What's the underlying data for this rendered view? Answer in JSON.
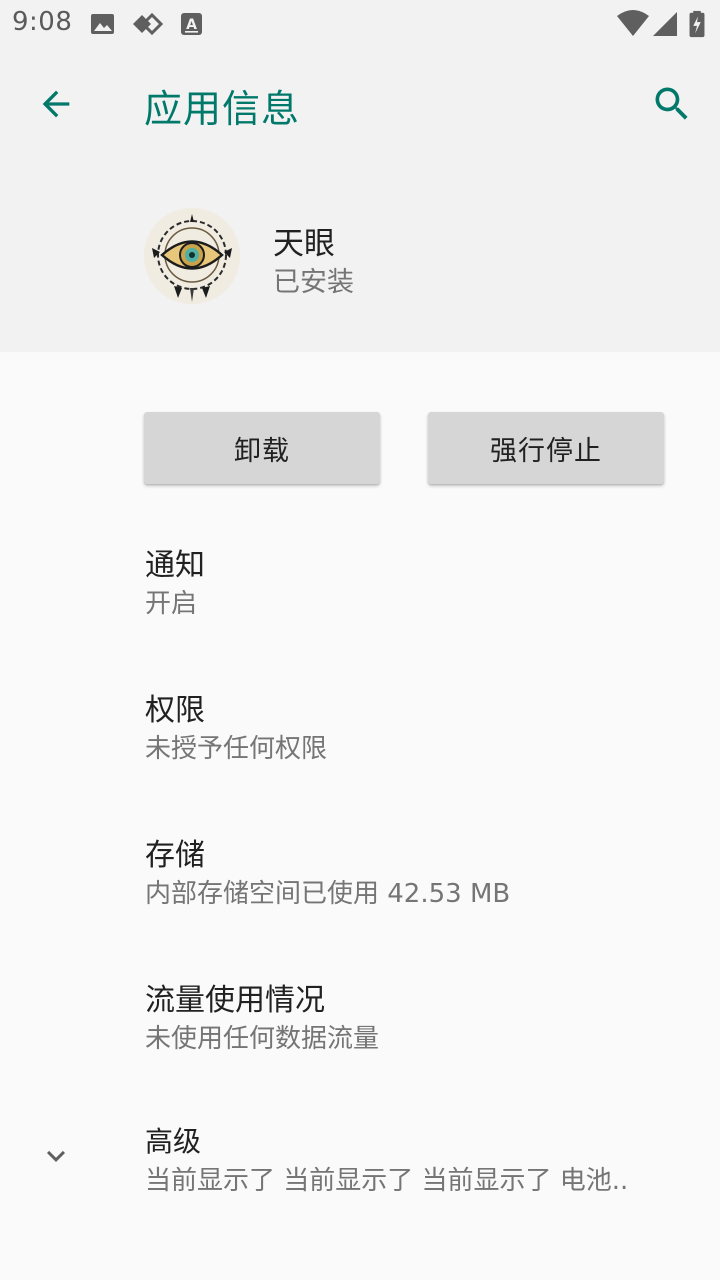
{
  "status_bar": {
    "time": "9:08",
    "left_icons": [
      "image-icon",
      "drive-sync-icon",
      "font-a-icon"
    ],
    "right_icons": [
      "wifi-icon",
      "cell-signal-icon",
      "battery-charging-icon"
    ]
  },
  "app_bar": {
    "title": "应用信息",
    "back_icon": "arrow-back-icon",
    "search_icon": "search-icon",
    "accent_color": "#00796b"
  },
  "app": {
    "name": "天眼",
    "status": "已安装",
    "icon": "eye-emblem-icon"
  },
  "buttons": {
    "uninstall": "卸载",
    "force_stop": "强行停止"
  },
  "preferences": [
    {
      "title": "通知",
      "summary": "开启"
    },
    {
      "title": "权限",
      "summary": "未授予任何权限"
    },
    {
      "title": "存储",
      "summary": "内部存储空间已使用 42.53 MB"
    },
    {
      "title": "流量使用情况",
      "summary": "未使用任何数据流量"
    },
    {
      "title": "高级",
      "summary": "当前显示了 当前显示了 当前显示了 电池..",
      "icon": "chevron-down-icon"
    }
  ]
}
